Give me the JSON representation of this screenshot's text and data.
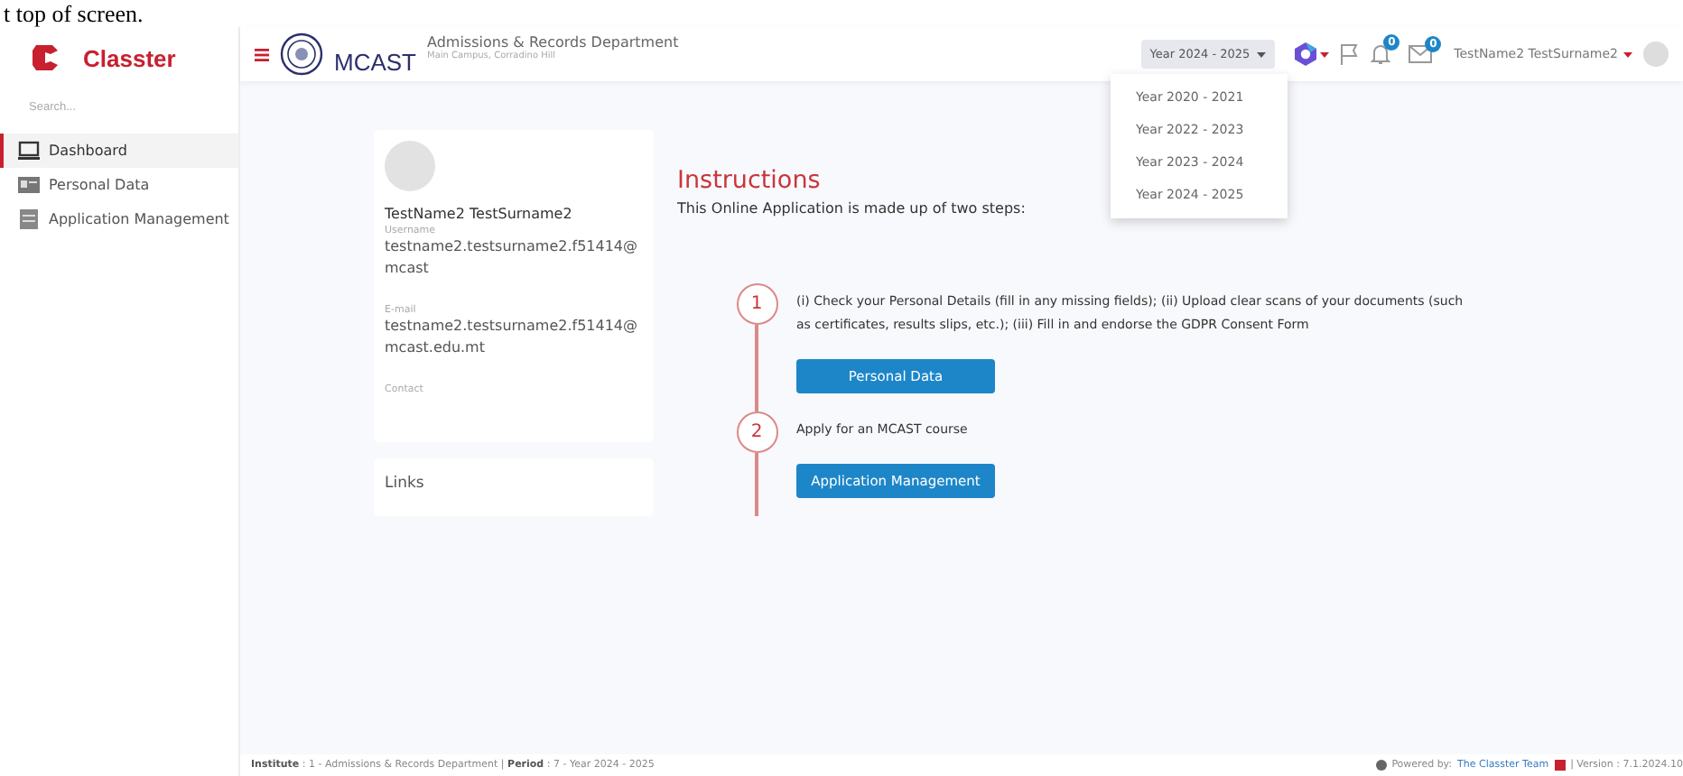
{
  "caption": "t top of screen.",
  "sidebar": {
    "brand": "Classter",
    "search": {
      "placeholder": "Search..."
    },
    "items": [
      {
        "label": "Dashboard",
        "selected": true,
        "kind": "monitor"
      },
      {
        "label": "Personal Data",
        "selected": false,
        "kind": "card"
      },
      {
        "label": "Application Management",
        "selected": false,
        "kind": "form"
      }
    ]
  },
  "header": {
    "brand": "MCAST",
    "title": "Admissions & Records Department",
    "subtitle": "Main Campus, Corradino Hill",
    "year_select": {
      "value": "Year 2024 - 2025",
      "expanded": true,
      "options": [
        {
          "label": "Year 2020 - 2021"
        },
        {
          "label": "Year 2022 - 2023"
        },
        {
          "label": "Year 2023 - 2024"
        },
        {
          "label": "Year 2024 - 2025"
        }
      ]
    },
    "notifications": "0",
    "messages": "0",
    "user": "TestName2 TestSurname2"
  },
  "profile": {
    "name": "TestName2 TestSurname2",
    "fields": [
      {
        "label": "Username",
        "value": "testname2.testsurname2.f51414@mcast"
      },
      {
        "label": "E-mail",
        "value": "testname2.testsurname2.f51414@mcast.edu.mt"
      },
      {
        "label": "Contact"
      }
    ]
  },
  "links": {
    "title": "Links"
  },
  "instructions": {
    "title": "Instructions",
    "intro": "This Online Application is made up of two steps:",
    "steps": [
      {
        "number": "1",
        "text": "(i) Check your Personal Details (fill in any missing fields);  (ii) Upload clear scans of your documents (such as certificates, results slips, etc.);  (iii) Fill in and endorse the GDPR Consent Form",
        "button": "Personal Data"
      },
      {
        "number": "2",
        "text": "Apply for an MCAST course",
        "button": "Application Management"
      }
    ]
  },
  "footer": {
    "left": "**Institute** : 1 - Admissions & Records Department  |  **Period** : 7 - Year 2024 - 2025",
    "powered_label": "Powered by:",
    "powered_link": "The Classter Team",
    "version": "| Version : 7.1.2024.10"
  }
}
